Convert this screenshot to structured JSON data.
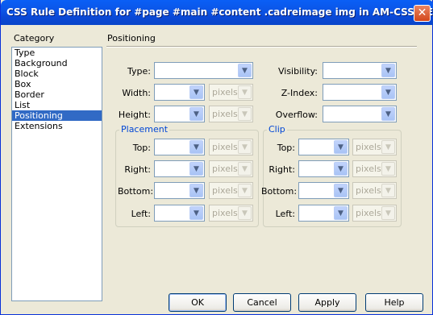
{
  "window": {
    "title": "CSS Rule Definition for #page #main #content .cadreimage img in AM-CSS-NEW..."
  },
  "category": {
    "label": "Category",
    "items": [
      "Type",
      "Background",
      "Block",
      "Box",
      "Border",
      "List",
      "Positioning",
      "Extensions"
    ],
    "selected": "Positioning"
  },
  "section": {
    "title": "Positioning"
  },
  "fields": {
    "type": {
      "label": "Type:",
      "value": ""
    },
    "visibility": {
      "label": "Visibility:",
      "value": ""
    },
    "width": {
      "label": "Width:",
      "value": "",
      "unit": "pixels"
    },
    "z_index": {
      "label": "Z-Index:",
      "value": ""
    },
    "height": {
      "label": "Height:",
      "value": "",
      "unit": "pixels"
    },
    "overflow": {
      "label": "Overflow:",
      "value": ""
    }
  },
  "placement": {
    "legend": "Placement",
    "top": {
      "label": "Top:",
      "value": "",
      "unit": "pixels"
    },
    "right": {
      "label": "Right:",
      "value": "",
      "unit": "pixels"
    },
    "bottom": {
      "label": "Bottom:",
      "value": "",
      "unit": "pixels"
    },
    "left": {
      "label": "Left:",
      "value": "",
      "unit": "pixels"
    }
  },
  "clip": {
    "legend": "Clip",
    "top": {
      "label": "Top:",
      "value": "",
      "unit": "pixels"
    },
    "right": {
      "label": "Right:",
      "value": "",
      "unit": "pixels"
    },
    "bottom": {
      "label": "Bottom:",
      "value": "",
      "unit": "pixels"
    },
    "left": {
      "label": "Left:",
      "value": "",
      "unit": "pixels"
    }
  },
  "buttons": {
    "ok": "OK",
    "cancel": "Cancel",
    "apply": "Apply",
    "help": "Help"
  },
  "icons": {
    "close": "close-icon",
    "dropdown": "chevron-down-icon"
  },
  "colors": {
    "titlebar": "#0a5ff6",
    "selection": "#316ac5",
    "group_legend": "#0046d5"
  }
}
